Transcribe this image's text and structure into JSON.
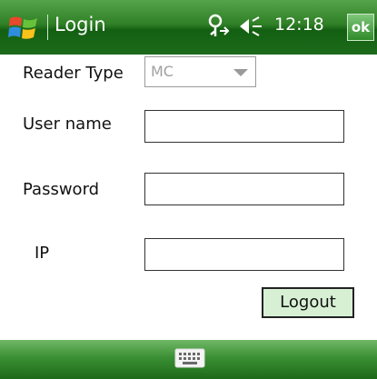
{
  "titlebar": {
    "title": "Login",
    "clock": "12:18",
    "ok_label": "ok",
    "icons": [
      "windows-start-icon",
      "connectivity-icon",
      "volume-icon"
    ]
  },
  "form": {
    "reader_type_label": "Reader Type",
    "reader_type_value": "MC",
    "username_label": "User name",
    "username_value": "",
    "password_label": "Password",
    "password_value": "",
    "ip_label": "IP",
    "ip_value": "",
    "logout_label": "Logout"
  },
  "bottombar": {
    "icons": [
      "keyboard-icon"
    ]
  },
  "colors": {
    "bar_green": "#2f7f26",
    "button_green": "#d7f0d4"
  }
}
